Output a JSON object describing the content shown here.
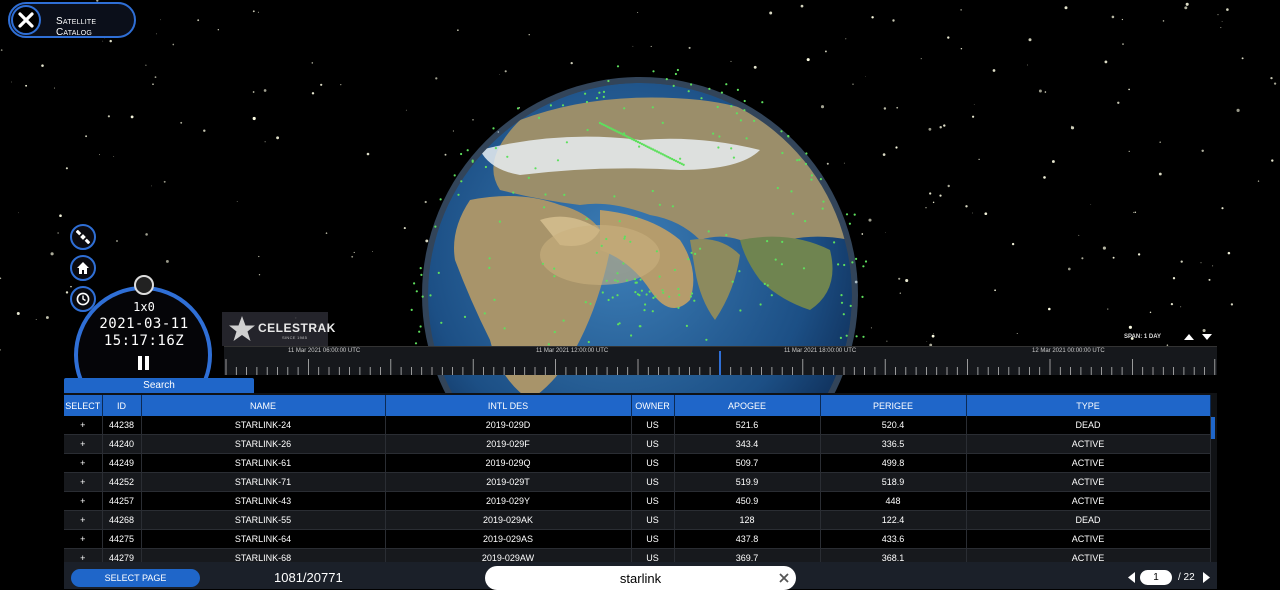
{
  "header": {
    "title": "Satellite Catalog",
    "close_icon": "close-icon"
  },
  "side_buttons": [
    {
      "icon": "satellite-icon"
    },
    {
      "icon": "home-icon"
    },
    {
      "icon": "clock-icon"
    }
  ],
  "clock": {
    "speed": "1x0",
    "date": "2021-03-11",
    "time": "15:17:16Z"
  },
  "branding": {
    "name": "CELESTRAK",
    "sub": "SINCE 1985"
  },
  "timeline": {
    "span_label": "SPAN: 1 DAY",
    "labels": [
      "11 Mar 2021 06:00:00 UTC",
      "11 Mar 2021 12:00:00 UTC",
      "11 Mar 2021 18:00:00 UTC",
      "12 Mar 2021 00:00:00 UTC"
    ]
  },
  "search_panel": {
    "tab_label": "Search",
    "columns": [
      "SELECT",
      "ID",
      "NAME",
      "INTL DES",
      "OWNER",
      "APOGEE",
      "PERIGEE",
      "TYPE"
    ],
    "rows": [
      [
        "+",
        "44238",
        "STARLINK-24",
        "2019-029D",
        "US",
        "521.6",
        "520.4",
        "DEAD"
      ],
      [
        "+",
        "44240",
        "STARLINK-26",
        "2019-029F",
        "US",
        "343.4",
        "336.5",
        "ACTIVE"
      ],
      [
        "+",
        "44249",
        "STARLINK-61",
        "2019-029Q",
        "US",
        "509.7",
        "499.8",
        "ACTIVE"
      ],
      [
        "+",
        "44252",
        "STARLINK-71",
        "2019-029T",
        "US",
        "519.9",
        "518.9",
        "ACTIVE"
      ],
      [
        "+",
        "44257",
        "STARLINK-43",
        "2019-029Y",
        "US",
        "450.9",
        "448",
        "ACTIVE"
      ],
      [
        "+",
        "44268",
        "STARLINK-55",
        "2019-029AK",
        "US",
        "128",
        "122.4",
        "DEAD"
      ],
      [
        "+",
        "44275",
        "STARLINK-64",
        "2019-029AS",
        "US",
        "437.8",
        "433.6",
        "ACTIVE"
      ],
      [
        "+",
        "44279",
        "STARLINK-68",
        "2019-029AW",
        "US",
        "369.7",
        "368.1",
        "ACTIVE"
      ]
    ]
  },
  "footer": {
    "select_page_label": "SELECT PAGE",
    "count": "1081/20771",
    "search_value": "starlink",
    "page": "1",
    "total_pages": "/ 22"
  },
  "colors": {
    "accent": "#1f66c9",
    "ring": "#2f6fd6",
    "satellite_dots": "#5ee05e",
    "panel": "#101215"
  }
}
